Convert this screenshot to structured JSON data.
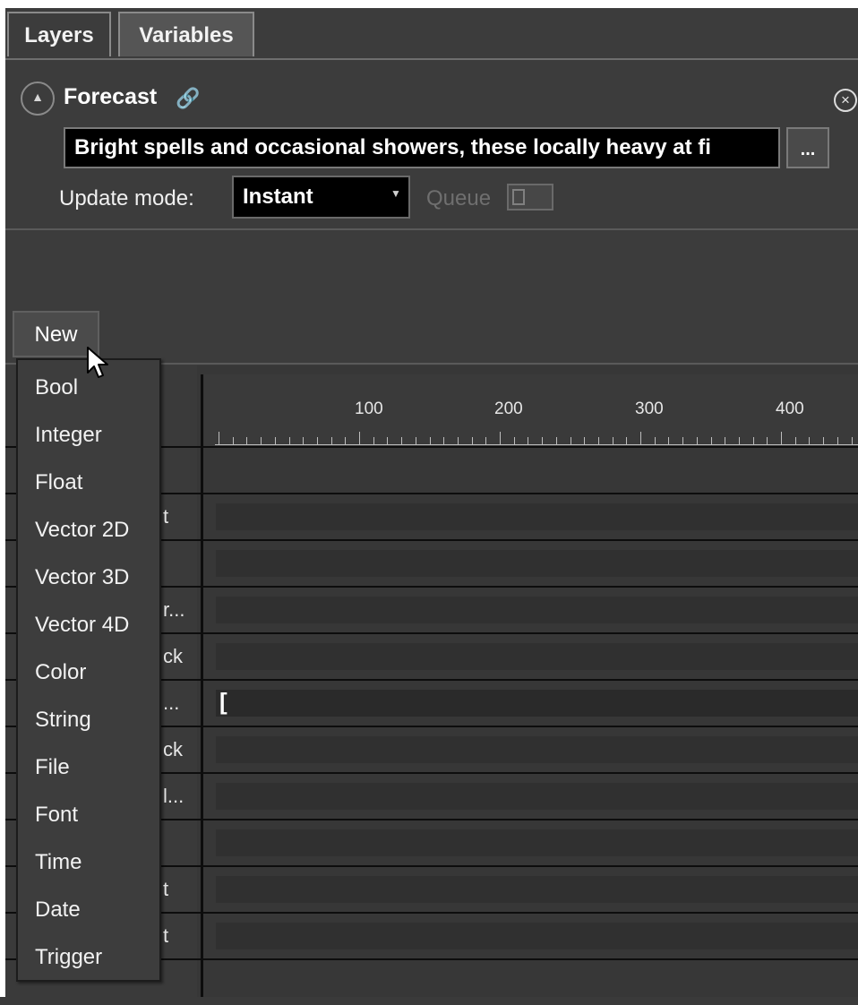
{
  "tabs": [
    {
      "label": "Layers"
    },
    {
      "label": "Variables"
    }
  ],
  "variable": {
    "name": "Forecast",
    "value": "Bright spells and occasional showers, these locally heavy at fi",
    "more_label": "...",
    "update_mode_label": "Update mode:",
    "update_mode_value": "Instant",
    "queue_label": "Queue"
  },
  "new_button": {
    "label": "New"
  },
  "menu": {
    "items": [
      "Bool",
      "Integer",
      "Float",
      "Vector 2D",
      "Vector 3D",
      "Vector 4D",
      "Color",
      "String",
      "File",
      "Font",
      "Time",
      "Date",
      "Trigger"
    ]
  },
  "ruler": {
    "labels": [
      "100",
      "200",
      "300",
      "400"
    ]
  },
  "rows": [
    {
      "name": ""
    },
    {
      "name": "t"
    },
    {
      "name": ""
    },
    {
      "name": "r..."
    },
    {
      "name": "ck"
    },
    {
      "name": "..."
    },
    {
      "name": "ck"
    },
    {
      "name": "l..."
    },
    {
      "name": ""
    },
    {
      "name": "t"
    },
    {
      "name": "t"
    }
  ],
  "icons": {
    "collapse": "chevron-up-icon",
    "link": "link-icon",
    "close": "close-circle-icon",
    "dropdown": "dropdown-arrow-icon",
    "cursor": "mouse-pointer-icon"
  }
}
